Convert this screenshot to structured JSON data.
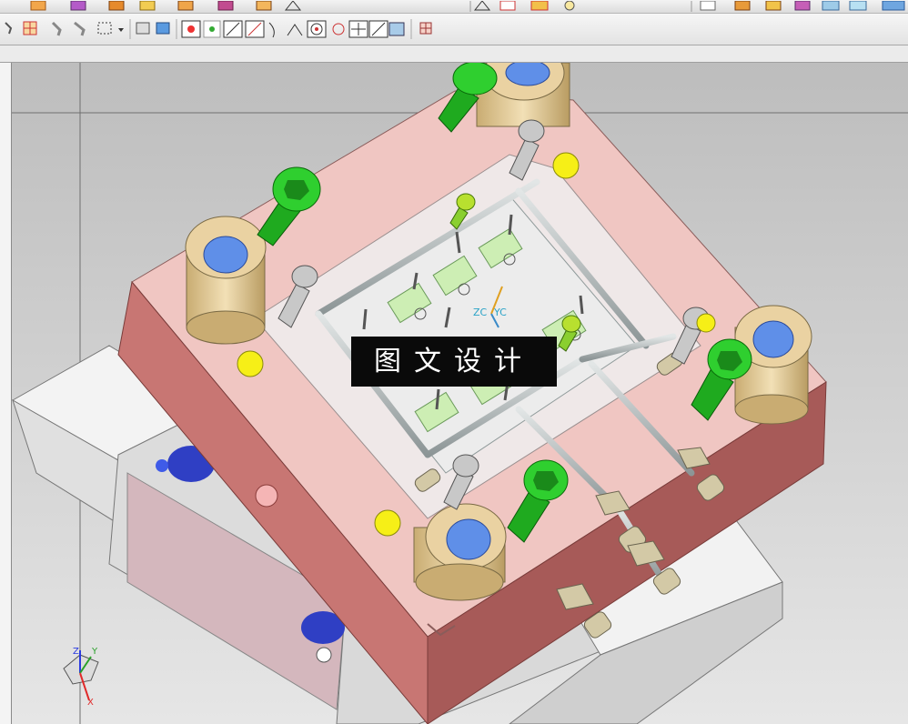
{
  "colors": {
    "clamp_plate": "#f0c6c2",
    "plate_side": "#c87673",
    "plate_dark": "#a75a58",
    "mold_base": "#e9e9e9",
    "leader_bushing": "#ead2a2",
    "bushing_blue": "#5f8fe8",
    "screw_green": "#2fcf2f",
    "ejector_yellow": "#f6ef17",
    "cavity_green": "#cdeeb4",
    "water_pipe": "#b9c2c4",
    "fitting": "#d3c9a6"
  },
  "toolbar": {
    "row1_icons": [
      "insert-icon",
      "block-icon",
      "boolean-icon",
      "part-icon",
      "drafting-icon",
      "extrude-icon",
      "sketch-icon",
      "triangle-icon",
      "plane-icon",
      "point-icon",
      "view-icon",
      "shade-icon",
      "render-icon",
      "material-icon",
      "lighting-icon"
    ],
    "row2_icons": [
      "select-icon",
      "snap-point-icon",
      "move-icon",
      "rotate-icon",
      "box-select-icon",
      "dropdown-icon",
      "shaded-icon",
      "cube-icon",
      "end-point-icon",
      "mid-point-icon",
      "line-icon",
      "arc-icon",
      "curve-icon",
      "tangent-icon",
      "center-icon",
      "quadrant-icon",
      "intersection-icon",
      "control-point-icon",
      "perpendicular-icon",
      "grid-icon"
    ]
  },
  "watermark": {
    "text": "图文设计"
  },
  "wcs": {
    "zc": "ZC",
    "yc": "YC"
  },
  "triad": {
    "x": "X",
    "y": "Y",
    "z": "Z"
  }
}
